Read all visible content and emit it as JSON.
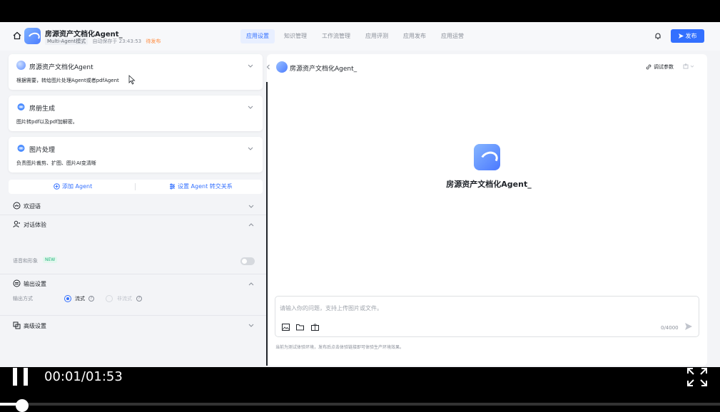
{
  "header": {
    "title": "房源资产文档化Agent_",
    "mode": "Multi-Agent模式",
    "autosave": "自动保存于 23:43:53",
    "status": "待发布",
    "tabs": [
      {
        "label": "应用设置",
        "active": true
      },
      {
        "label": "知识管理",
        "active": false
      },
      {
        "label": "工作流管理",
        "active": false
      },
      {
        "label": "应用评测",
        "active": false
      },
      {
        "label": "应用发布",
        "active": false
      },
      {
        "label": "应用运营",
        "active": false
      }
    ],
    "publish_label": "发布"
  },
  "agents": [
    {
      "name": "房源资产文档化Agent",
      "desc": "根据需要，转给图片处理Agent或者pdfAgent",
      "icon": "gradient-ball-icon"
    },
    {
      "name": "房册生成",
      "desc": "图片转pdf以及pdf加解密。",
      "icon": "robot-icon"
    },
    {
      "name": "图片处理",
      "desc": "负责图片裁剪、扩图、图片AI变清晰",
      "icon": "robot-icon"
    }
  ],
  "actions": {
    "add_agent": "添加 Agent",
    "set_transfer": "设置 Agent 转交关系"
  },
  "sections": {
    "welcome": "欢迎语",
    "dialog": "对话体验",
    "voice_label": "语音和形象",
    "new_badge": "NEW",
    "output": "输出设置",
    "output_mode_label": "输出方式",
    "stream": "流式",
    "non_stream": "非流式",
    "advanced": "高级设置"
  },
  "preview": {
    "title": "房源资产文档化Agent_",
    "debug_label": "调试参数",
    "center_title": "房源资产文档化Agent_",
    "input_placeholder": "请输入你的问题，支持上传图片或文件。",
    "counter": "0/4000",
    "disclaimer": "当前为测试体验环境，发布后点击体验链接即可体验生产环境效果。"
  },
  "player": {
    "time": "00:01/01:53",
    "progress": 0.009
  },
  "colors": {
    "accent": "#3370ff",
    "pending": "#ff8a3d",
    "new_badge": "#21b37c"
  }
}
